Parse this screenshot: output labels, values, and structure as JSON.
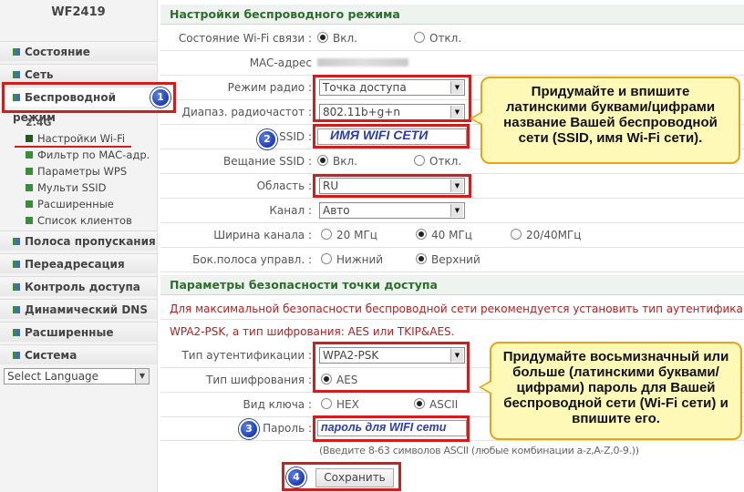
{
  "sidebar": {
    "model": "WF2419",
    "nav": [
      "Состояние",
      "Сеть",
      "Беспроводной режим",
      "Полоса пропускания",
      "Переадресация",
      "Контроль доступа",
      "Динамический DNS",
      "Расширенные",
      "Система"
    ],
    "band": "2.4G",
    "sub": [
      "Настройки Wi-Fi",
      "Фильтр по МАС-адр.",
      "Параметры WPS",
      "Мульти SSID",
      "Расширенные",
      "Список клиентов"
    ],
    "language": "Select Language"
  },
  "wireless": {
    "title": "Настройки беспроводного режима",
    "status_label": "Состояние Wi-Fi связи :",
    "status_on": "Вкл.",
    "status_off": "Откл.",
    "mac_label": "MAC-адрес",
    "mode_label": "Режим радио :",
    "mode_value": "Точка доступа",
    "band_label": "Диапаз. радиочастот :",
    "band_value": "802.11b+g+n",
    "ssid_label": "SSID :",
    "ssid_value": "ИМЯ WIFI СЕТИ",
    "bcast_label": "Вещание SSID :",
    "bcast_on": "Вкл.",
    "bcast_off": "Откл.",
    "region_label": "Область :",
    "region_value": "RU",
    "channel_label": "Канал :",
    "channel_value": "Авто",
    "width_label": "Ширина канала :",
    "width_20": "20 МГц",
    "width_40": "40 МГц",
    "width_2040": "20/40МГц",
    "side_label": "Бок.полоса управл. :",
    "side_lower": "Нижний",
    "side_upper": "Верхний"
  },
  "security": {
    "title": "Параметры безопасности точки доступа",
    "notice1": "Для максимальной безопасности беспроводной сети рекомендуется установить тип аутентификации:",
    "notice2": "WPA2-PSK, а тип шифрования: AES или TKIP&AES.",
    "auth_label": "Тип аутентификации :",
    "auth_value": "WPA2-PSK",
    "enc_label": "Тип шифрования :",
    "enc_value": "AES",
    "key_label": "Вид ключа :",
    "key_hex": "HEX",
    "key_ascii": "ASCII",
    "pass_label": "Пароль :",
    "pass_value": "пароль для WIFI сети",
    "hint": "(Введите 8-63 символов ASCII (любые комбинации a-z,A-Z,0-9.))",
    "save": "Сохранить"
  },
  "callouts": {
    "ssid": "Придумайте и впишите латинскими буквами/цифрами название Вашей беспроводной сети (SSID, имя Wi-Fi сети).",
    "password": "Придумайте восьмизначный или больше (латинскими буквами/цифрами) пароль для Вашей беспроводной сети (Wi-Fi сети) и впишите его."
  },
  "badges": [
    "1",
    "2",
    "3",
    "4"
  ],
  "colors": {
    "accent": "#2c6e2c",
    "annotation_red": "#d21d1d",
    "callout_bg": "#fff9b8",
    "callout_border": "#e7a414",
    "badge_blue": "#1e3db3"
  }
}
